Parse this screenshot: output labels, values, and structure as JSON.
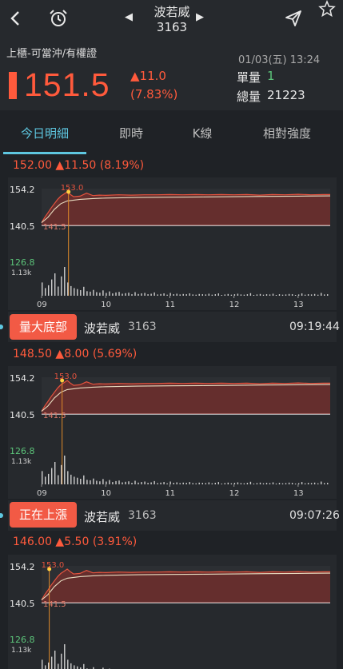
{
  "header": {
    "stock_name": "波若威",
    "stock_code": "3163",
    "prev_arrow": "◀",
    "next_arrow": "▶"
  },
  "quote": {
    "market": "上櫃-可當沖/有權證",
    "datetime": "01/03(五) 13:24",
    "price": "151.5",
    "change": "▲11.0",
    "change_pct": "(7.83%)",
    "unit_vol_label": "單量",
    "unit_vol": "1",
    "total_vol_label": "總量",
    "total_vol": "21223"
  },
  "tabs": [
    {
      "label": "今日明細",
      "active": true
    },
    {
      "label": "即時"
    },
    {
      "label": "K線"
    },
    {
      "label": "相對強度"
    }
  ],
  "colors": {
    "up": "#ff5a3c",
    "accent": "#5ec7e0",
    "green": "#5cc47a",
    "bg": "#1f2226",
    "panel": "#26292d"
  },
  "cards": [
    {
      "price_line": "152.00 ▲11.50 (8.19%)",
      "marker": "153.0",
      "marker_time": 9.42,
      "alert": null
    },
    {
      "price_line": "148.50 ▲8.00 (5.69%)",
      "marker": "153.0",
      "marker_time": 9.32,
      "alert": {
        "tag": "量大底部",
        "name": "波若威",
        "code": "3163",
        "time": "09:19:44"
      }
    },
    {
      "price_line": "146.00 ▲5.50 (3.91%)",
      "marker": "153.0",
      "marker_time": 9.12,
      "alert": {
        "tag": "正在上漲",
        "name": "波若威",
        "code": "3163",
        "time": "09:07:26"
      }
    }
  ],
  "chart_data": {
    "type": "area",
    "title": "",
    "ylim": [
      140.5,
      154.2
    ],
    "y_ticks": [
      "154.2",
      "140.5",
      "126.8"
    ],
    "ref_price_label": "141.5",
    "ref_price": 140.5,
    "volume_max_label": "1.13k",
    "x_ticks": [
      "09",
      "10",
      "11",
      "12",
      "13"
    ],
    "x_range": [
      9,
      13.5
    ],
    "series": [
      {
        "x": [
          9.0,
          9.05,
          9.1,
          9.15,
          9.2,
          9.25,
          9.3,
          9.35,
          9.4,
          9.45,
          9.5,
          9.6,
          9.7,
          9.8,
          9.9,
          10.0,
          10.2,
          10.4,
          10.6,
          10.8,
          11.0,
          11.2,
          11.4,
          11.6,
          11.8,
          12.0,
          12.2,
          12.4,
          12.6,
          12.8,
          13.0,
          13.2,
          13.4,
          13.5
        ],
        "values": [
          141.5,
          143.5,
          145.2,
          147.0,
          148.6,
          150.2,
          151.4,
          152.2,
          153.0,
          152.0,
          151.2,
          151.4,
          152.5,
          151.6,
          151.8,
          151.7,
          151.9,
          151.8,
          151.9,
          151.9,
          152.0,
          151.9,
          152.0,
          151.9,
          152.0,
          151.9,
          152.0,
          151.8,
          152.0,
          151.9,
          152.1,
          151.9,
          152.0,
          152.0
        ]
      },
      {
        "x": [
          9.0,
          9.1,
          9.2,
          9.3,
          9.4,
          9.6,
          9.8,
          10.0,
          10.5,
          11.0,
          11.5,
          12.0,
          12.5,
          13.0,
          13.5
        ],
        "values": [
          141.5,
          143.5,
          146.5,
          148.6,
          149.6,
          150.2,
          150.5,
          150.7,
          150.9,
          151.0,
          151.1,
          151.2,
          151.3,
          151.4,
          151.5
        ]
      }
    ],
    "volume": {
      "x_start": 9.0,
      "x_step": 0.05,
      "values": [
        520,
        300,
        410,
        640,
        880,
        360,
        760,
        1130,
        520,
        380,
        300,
        260,
        220,
        350,
        180,
        160,
        230,
        140,
        120,
        210,
        110,
        170,
        90,
        130,
        150,
        80,
        100,
        120,
        60,
        140,
        70,
        90,
        110,
        60,
        80,
        130,
        50,
        70,
        90,
        40,
        110,
        60,
        80,
        50,
        70,
        60,
        90,
        50,
        40,
        70,
        60,
        50,
        80,
        40,
        60,
        90,
        30,
        50,
        70,
        40,
        60,
        80,
        50,
        40,
        60,
        100,
        30,
        50,
        70,
        40,
        60,
        50,
        80,
        30,
        60,
        40,
        50,
        70,
        60,
        30,
        50,
        90,
        40,
        60,
        50,
        70,
        40,
        110,
        50,
        60
      ]
    }
  }
}
